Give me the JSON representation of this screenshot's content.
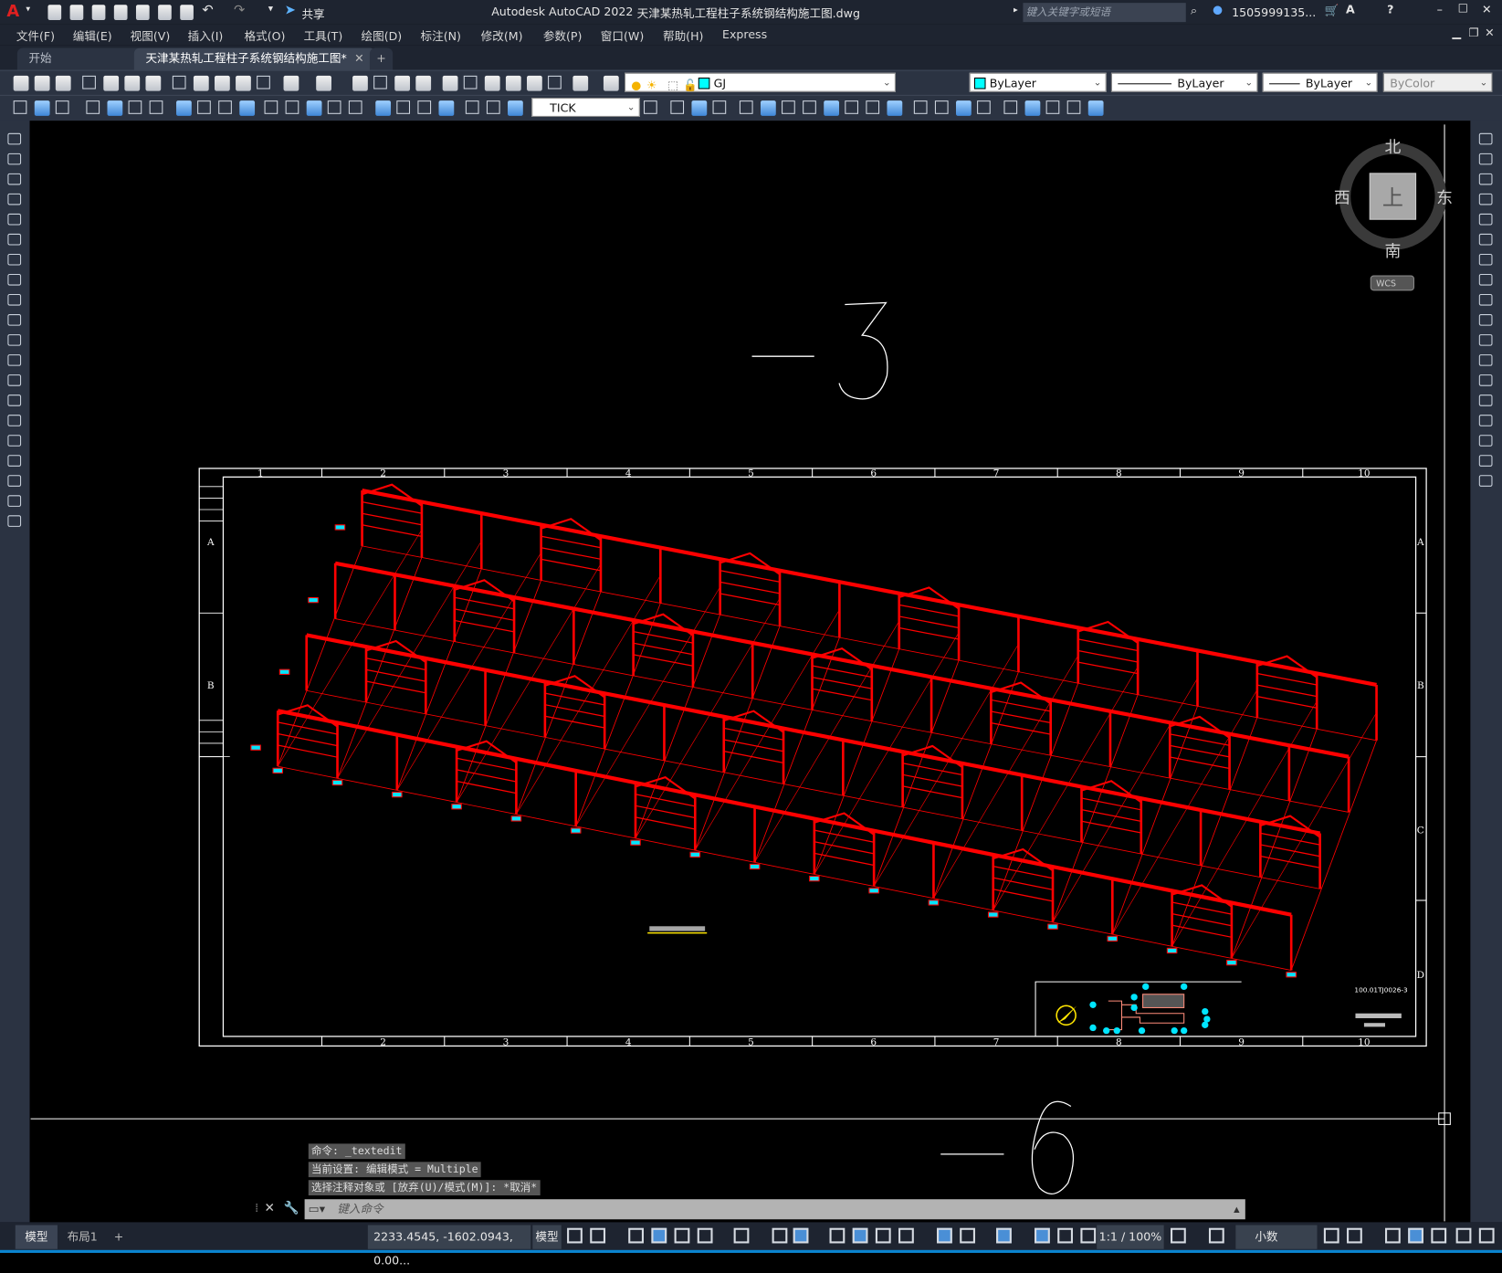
{
  "app": {
    "title": "Autodesk AutoCAD 2022",
    "filename": "天津某热轧工程柱子系统钢结构施工图.dwg",
    "share_label": "共享",
    "search_placeholder": "键入关键字或短语",
    "user": "1505999135..."
  },
  "menu": [
    "文件(F)",
    "编辑(E)",
    "视图(V)",
    "插入(I)",
    "格式(O)",
    "工具(T)",
    "绘图(D)",
    "标注(N)",
    "修改(M)",
    "参数(P)",
    "窗口(W)",
    "帮助(H)",
    "Express"
  ],
  "tabs": {
    "start": "开始",
    "active": "天津某热轧工程柱子系统钢结构施工图*",
    "new_tab": "+",
    "close": "✕"
  },
  "toolbar": {
    "layer": "GJ",
    "layer_color": "#00ffff",
    "color": "ByLayer",
    "linetype": "ByLayer",
    "lineweight": "ByLayer",
    "plotstyle": "ByColor",
    "dimstyle": "TICK"
  },
  "viewcube": {
    "north": "北",
    "south": "南",
    "west": "西",
    "east": "东",
    "face": "上",
    "wcs": "WCS"
  },
  "drawing": {
    "big_label_1": "3",
    "big_label_2": "6",
    "top_cols": [
      "1",
      "2",
      "3",
      "4",
      "5",
      "6",
      "7",
      "8",
      "9",
      "10"
    ],
    "bottom_cols": [
      "2",
      "3",
      "4",
      "5",
      "6",
      "7",
      "8",
      "9",
      "10"
    ],
    "left_rows": [
      "A",
      "B"
    ],
    "right_rows": [
      "A",
      "B",
      "C",
      "D"
    ],
    "drawing_no": "100.01TJ0026-3",
    "structure_color": "#ff0000",
    "marker_color": "#00e5ff"
  },
  "command": {
    "history": [
      "命令: _textedit",
      "当前设置: 编辑模式 = Multiple",
      "选择注释对象或 [放弃(U)/模式(M)]: *取消*"
    ],
    "placeholder": "键入命令"
  },
  "status": {
    "layout_tabs": [
      "模型",
      "布局1"
    ],
    "add_layout": "+",
    "coords": "2233.4545, -1602.0943, 0.00...",
    "space": "模型",
    "scale": "1:1 / 100%",
    "units": "小数"
  }
}
